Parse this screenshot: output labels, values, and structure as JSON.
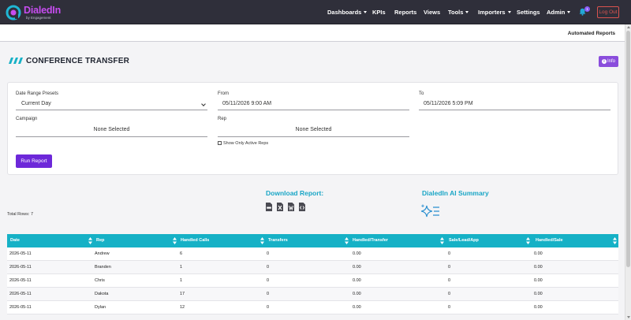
{
  "app": {
    "logo_name": "DialedIn",
    "logo_sub": "by Engagement"
  },
  "nav": {
    "items": [
      {
        "label": "Dashboards",
        "dropdown": true
      },
      {
        "label": "KPIs",
        "dropdown": false
      },
      {
        "label": "Reports",
        "dropdown": false
      },
      {
        "label": "Views",
        "dropdown": false
      },
      {
        "label": "Tools",
        "dropdown": true
      },
      {
        "label": "Importers",
        "dropdown": true
      },
      {
        "label": "Settings",
        "dropdown": false
      },
      {
        "label": "Admin",
        "dropdown": true
      }
    ],
    "notification_count": "1",
    "logout_label": "Log Out"
  },
  "subbar": {
    "link_label": "Automated Reports"
  },
  "page": {
    "title": "CONFERENCE TRANSFER",
    "info_label": "Info"
  },
  "filters": {
    "date_range_label": "Date Range Presets",
    "date_range_value": "Current Day",
    "from_label": "From",
    "from_value": "05/11/2026 9:00 AM",
    "to_label": "To",
    "to_value": "05/11/2026 5:09 PM",
    "campaign_label": "Campaign",
    "campaign_value": "None Selected",
    "rep_label": "Rep",
    "rep_value": "None Selected",
    "active_reps_label": "Show Only Active Reps",
    "active_reps_checked": false,
    "run_label": "Run Report"
  },
  "download": {
    "title": "Download Report:",
    "formats": [
      "pdf-file-icon",
      "excel-file-icon",
      "word-file-icon",
      "code-file-icon"
    ]
  },
  "ai_summary": {
    "title": "DialedIn AI Summary"
  },
  "table": {
    "total_rows_label": "Total Rows: 7",
    "columns": [
      "Date",
      "Rep",
      "Handled Calls",
      "Transfers",
      "Handled/Transfer",
      "Sale/Lead/App",
      "Handled/Sale"
    ],
    "rows": [
      [
        "2026-05-11",
        "Andrew",
        "6",
        "0",
        "0.00",
        "0",
        "0.00"
      ],
      [
        "2026-05-11",
        "Branden",
        "1",
        "0",
        "0.00",
        "0",
        "0.00"
      ],
      [
        "2026-05-11",
        "Chris",
        "1",
        "0",
        "0.00",
        "0",
        "0.00"
      ],
      [
        "2026-05-11",
        "Dakota",
        "17",
        "0",
        "0.00",
        "0",
        "0.00"
      ],
      [
        "2026-05-11",
        "Dylan",
        "12",
        "0",
        "0.00",
        "0",
        "0.00"
      ]
    ]
  },
  "colors": {
    "nav_bg": "#2f2f3a",
    "accent_purple": "#6d28d9",
    "table_header": "#16b1c6",
    "teal_text": "#1aa6c6"
  }
}
